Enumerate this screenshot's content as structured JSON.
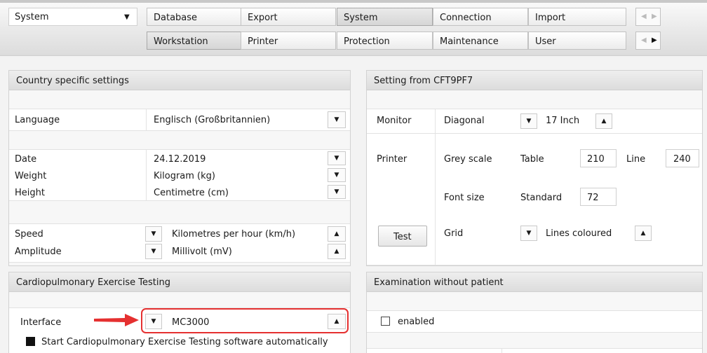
{
  "top_nav": {
    "module_select": {
      "value": "System"
    },
    "row1_tabs": [
      "Database",
      "Export",
      "System",
      "Connection",
      "Import"
    ],
    "row2_tabs": [
      "Workstation",
      "Printer",
      "Protection",
      "Maintenance",
      "User"
    ],
    "selected": [
      "System",
      "Workstation"
    ]
  },
  "country": {
    "title": "Country specific settings",
    "language": {
      "label": "Language",
      "value": "Englisch (Großbritannien)"
    },
    "date": {
      "label": "Date",
      "value": "24.12.2019"
    },
    "weight": {
      "label": "Weight",
      "value": "Kilogram (kg)"
    },
    "height": {
      "label": "Height",
      "value": "Centimetre (cm)"
    },
    "speed": {
      "label": "Speed",
      "value": "Kilometres per hour (km/h)"
    },
    "amplitude": {
      "label": "Amplitude",
      "value": "Millivolt (mV)"
    }
  },
  "setting": {
    "title": "Setting from  CFT9PF7",
    "monitor": {
      "label": "Monitor",
      "diagonal_label": "Diagonal",
      "diagonal_value": "17 Inch"
    },
    "printer": {
      "label": "Printer",
      "grey_scale_label": "Grey scale",
      "table_label": "Table",
      "table_value": "210",
      "line_label": "Line",
      "line_value": "240",
      "font_size_label": "Font size",
      "standard_label": "Standard",
      "standard_value": "72"
    },
    "test_button": "Test",
    "grid": {
      "label": "Grid",
      "value": "Lines coloured"
    }
  },
  "cpet": {
    "title": "Cardiopulmonary Exercise Testing",
    "interface": {
      "label": "Interface",
      "value": "MC3000"
    },
    "autostart": {
      "label": "Start Cardiopulmonary Exercise Testing software automatically",
      "checked": true
    }
  },
  "exam": {
    "title": "Examination without patient",
    "enabled": {
      "label": "enabled",
      "checked": false
    }
  },
  "colors": {
    "highlight": "#e53030",
    "arrow": "#e53030"
  }
}
